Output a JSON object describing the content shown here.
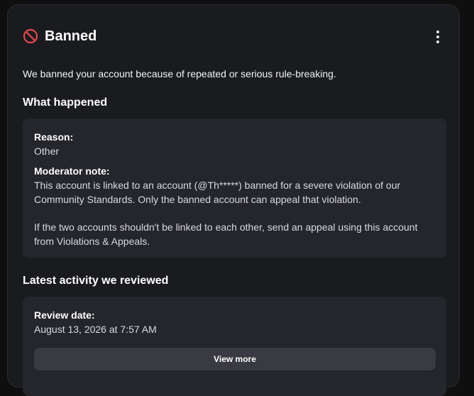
{
  "header": {
    "title": "Banned",
    "icon": "ban-icon",
    "menu_icon": "more-vertical-icon"
  },
  "summary": "We banned your account because of repeated or serious rule-breaking.",
  "what_happened": {
    "heading": "What happened",
    "reason_label": "Reason:",
    "reason_value": "Other",
    "note_label": "Moderator note:",
    "note_line1": "This account is linked to an account (@Th*****) banned for a severe violation of our",
    "note_line2": "Community Standards. Only the banned account can appeal that violation.",
    "note_line3": "If the two accounts shouldn't be linked to each other, send an appeal using this account",
    "note_line4": "from Violations & Appeals."
  },
  "latest_activity": {
    "heading": "Latest activity we reviewed",
    "review_date_label": "Review date:",
    "review_date_value": "August 13, 2026 at 7:57 AM",
    "view_more_label": "View more"
  },
  "colors": {
    "background": "#0f0f10",
    "card": "#1a1b1e",
    "panel": "#25262b",
    "button": "#3a3b42",
    "ban_red": "#e5484d"
  }
}
